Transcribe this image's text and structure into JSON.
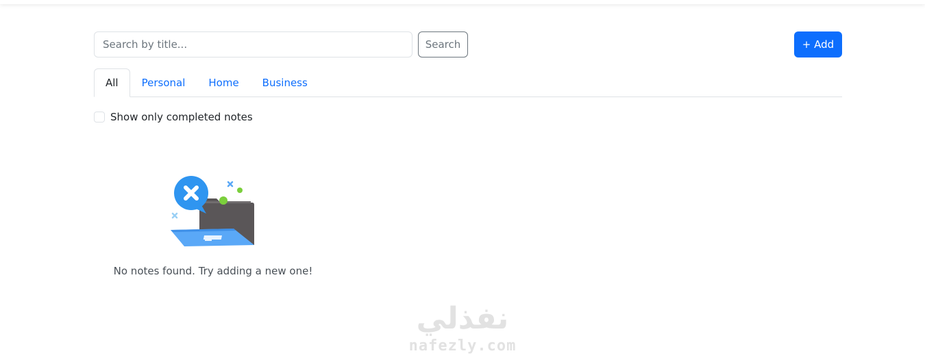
{
  "search": {
    "placeholder": "Search by title...",
    "value": "",
    "button_label": "Search"
  },
  "toolbar": {
    "add_label": "+ Add"
  },
  "tabs": [
    {
      "label": "All",
      "active": true
    },
    {
      "label": "Personal",
      "active": false
    },
    {
      "label": "Home",
      "active": false
    },
    {
      "label": "Business",
      "active": false
    }
  ],
  "filter": {
    "completed_label": "Show only completed notes",
    "checked": false
  },
  "empty_state": {
    "message": "No notes found. Try adding a new one!",
    "icon": "empty-folder-icon"
  },
  "watermark": {
    "arabic": "نفذلي",
    "latin": "nafezly.com"
  },
  "colors": {
    "primary": "#0d6efd",
    "secondary": "#6c757d",
    "border": "#dee2e6"
  }
}
